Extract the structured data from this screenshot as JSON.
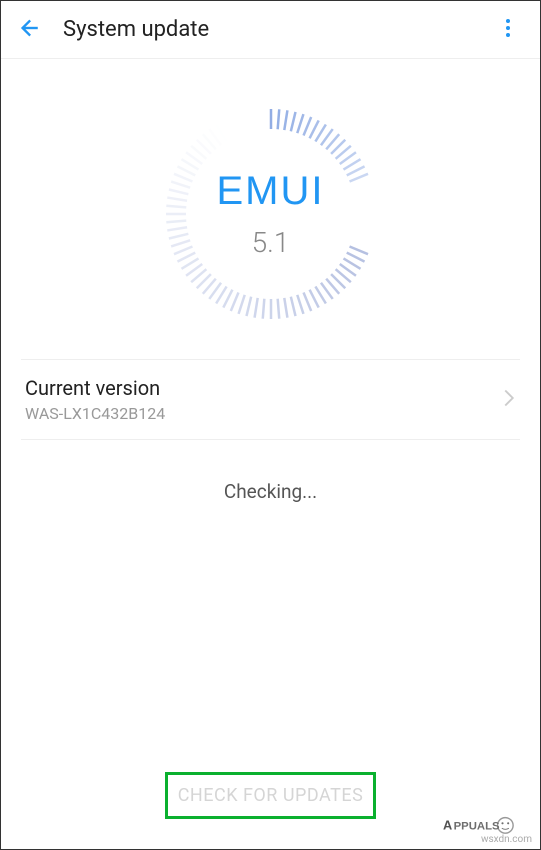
{
  "header": {
    "title": "System update"
  },
  "dial": {
    "brand": "EMUI",
    "version": "5.1"
  },
  "current_version": {
    "label": "Current version",
    "value": "WAS-LX1C432B124"
  },
  "status": "Checking...",
  "footer": {
    "check_button": "CHECK FOR UPDATES"
  },
  "watermark": "wsxdn.com",
  "colors": {
    "accent": "#2196f3",
    "highlight_border": "#0ab02e"
  }
}
